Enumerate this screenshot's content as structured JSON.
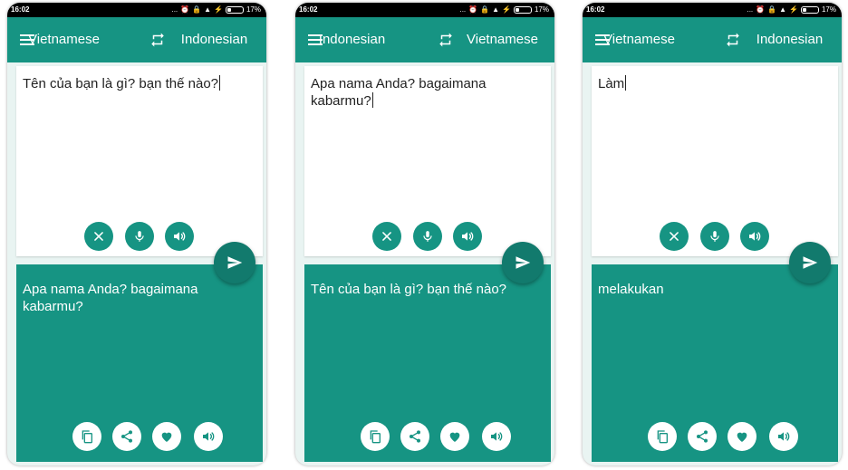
{
  "status_bar": {
    "time": "16:02",
    "battery": "17%",
    "dots": "..."
  },
  "screens": [
    {
      "source_language": "Vietnamese",
      "target_language": "Indonesian",
      "input_text": "Tên của bạn là gì? bạn thế nào?",
      "output_text": "Apa nama Anda? bagaimana kabarmu?"
    },
    {
      "source_language": "Indonesian",
      "target_language": "Vietnamese",
      "input_text": "Apa nama Anda? bagaimana kabarmu?",
      "output_text": "Tên của bạn là gì? bạn thế nào?"
    },
    {
      "source_language": "Vietnamese",
      "target_language": "Indonesian",
      "input_text": "Làm",
      "output_text": "melakukan"
    }
  ],
  "icons": {
    "menu": "menu-icon",
    "swap": "swap-icon",
    "clear": "close-icon",
    "mic": "microphone-icon",
    "speak": "speaker-icon",
    "send": "send-icon",
    "copy": "copy-icon",
    "share": "share-icon",
    "favorite": "heart-icon"
  },
  "colors": {
    "primary": "#169483",
    "primary_dark": "#127a6d",
    "background": "#e9f4f2",
    "status_bar": "#000000"
  }
}
